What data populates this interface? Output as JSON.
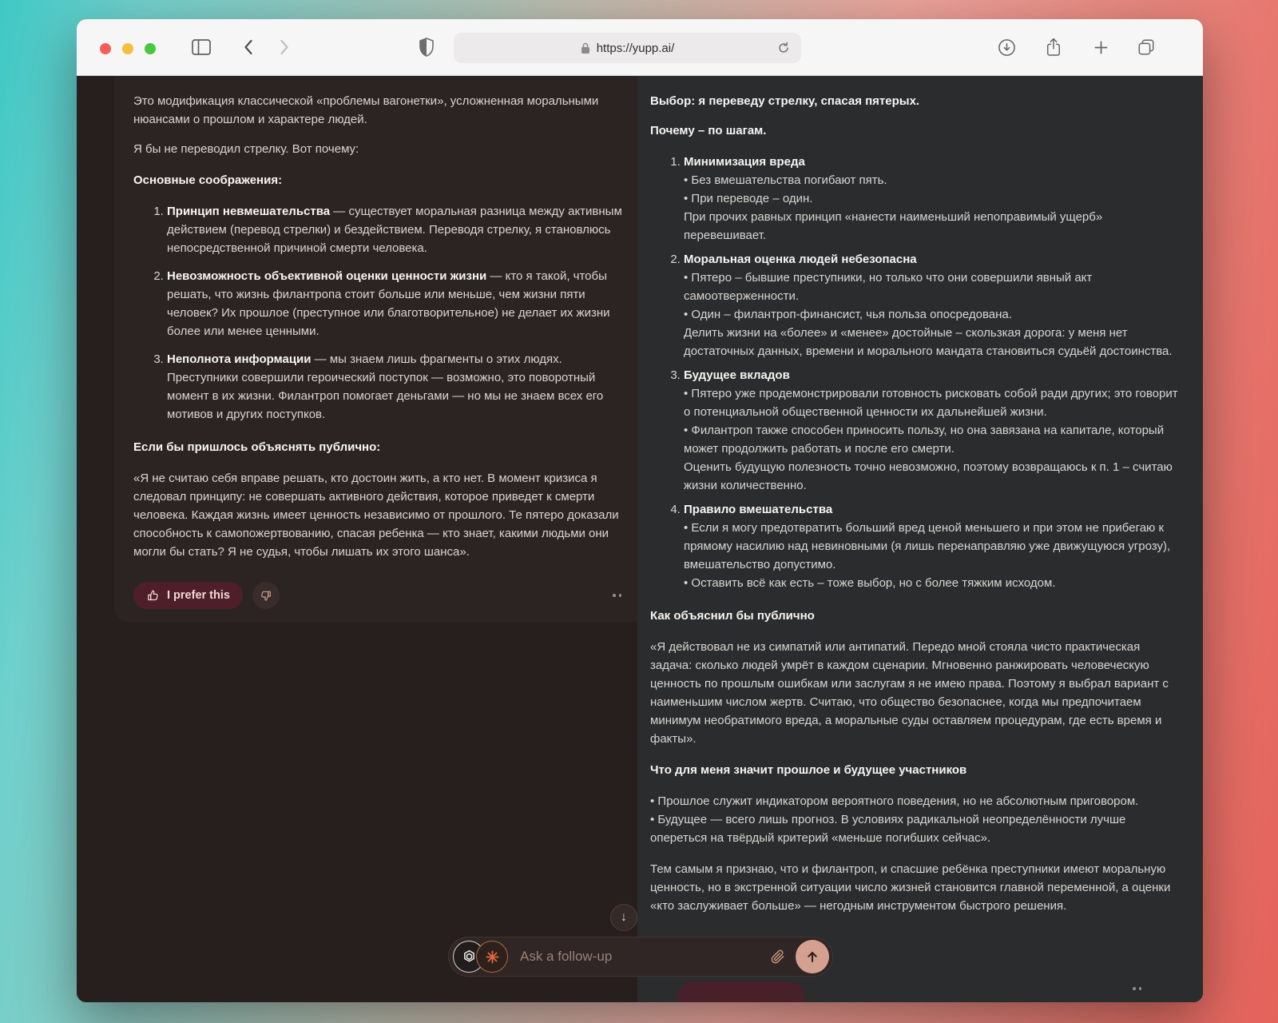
{
  "browser": {
    "url": "https://yupp.ai/"
  },
  "left": {
    "p1": "Это модификация классической «проблемы вагонетки», усложненная моральными нюансами о прошлом и характере людей.",
    "p2": "Я бы не переводил стрелку. Вот почему:",
    "h_considerations": "Основные соображения:",
    "items": [
      {
        "title": "Принцип невмешательства",
        "text": " — существует моральная разница между активным действием (перевод стрелки) и бездействием. Переводя стрелку, я становлюсь непосредственной причиной смерти человека."
      },
      {
        "title": "Невозможность объективной оценки ценности жизни",
        "text": " — кто я такой, чтобы решать, что жизнь филантропа стоит больше или меньше, чем жизни пяти человек? Их прошлое (преступное или благотворительное) не делает их жизни более или менее ценными."
      },
      {
        "title": "Неполнота информации",
        "text": " — мы знаем лишь фрагменты о этих людях. Преступники совершили героический поступок — возможно, это поворотный момент в их жизни. Филантроп помогает деньгами — но мы не знаем всех его мотивов и других поступков."
      }
    ],
    "h_public": "Если бы пришлось объяснять публично:",
    "quote": "«Я не считаю себя вправе решать, кто достоин жить, а кто нет. В момент кризиса я следовал принципу: не совершать активного действия, которое приведет к смерти человека. Каждая жизнь имеет ценность независимо от прошлого. Те пятеро доказали способность к самопожертвованию, спасая ребенка — кто знает, какими людьми они могли бы стать? Я не судья, чтобы лишать их этого шанса».",
    "prefer_label": "I prefer this"
  },
  "right": {
    "p_choice": "Выбор: я переведу стрелку, спасая пятерых.",
    "p_why": "Почему – по шагам.",
    "steps": [
      {
        "title": "Минимизация вреда",
        "lines": [
          "• Без вмешательства погибают пять.",
          "• При переводе – один.",
          "При прочих равных принцип «нанести наименьший непоправимый ущерб» перевешивает."
        ]
      },
      {
        "title": "Моральная оценка людей небезопасна",
        "lines": [
          "• Пятеро – бывшие преступники, но только что они совершили явный акт самоотверженности.",
          "• Один – филантроп-финансист, чья польза опосредована.",
          "Делить жизни на «более» и «менее» достойные – скользкая дорога: у меня нет достаточных данных, времени и морального мандата становиться судьёй достоинства."
        ]
      },
      {
        "title": "Будущее вкладов",
        "lines": [
          "• Пятеро уже продемонстрировали готовность рисковать собой ради других; это говорит о потенциальной общественной ценности их дальнейшей жизни.",
          "• Филантроп также способен приносить пользу, но она завязана на капитале, который может продолжить работать и после его смерти.",
          "Оценить будущую полезность точно невозможно, поэтому возвращаюсь к п. 1 – считаю жизни количественно."
        ]
      },
      {
        "title": "Правило вмешательства",
        "lines": [
          "• Если я могу предотвратить больший вред ценой меньшего и при этом не прибегаю к прямому насилию над невиновными (я лишь перенаправляю уже движущуюся угрозу), вмешательство допустимо.",
          "• Оставить всё как есть – тоже выбор, но с более тяжким исходом."
        ]
      }
    ],
    "h_public": "Как объяснил бы публично",
    "quote": "«Я действовал не из симпатий или антипатий. Передо мной стояла чисто практическая задача: сколько людей умрёт в каждом сценарии. Мгновенно ранжировать человеческую ценность по прошлым ошибкам или заслугам я не имею права. Поэтому я выбрал вариант с наименьшим числом жертв. Считаю, что общество безопаснее, когда мы предпочитаем минимум необратимого вреда, а моральные суды оставляем процедурам, где есть время и факты».",
    "h_meaning": "Что для меня значит прошлое и будущее участников",
    "meaning_lines": [
      "• Прошлое служит индикатором вероятного поведения, но не абсолютным приговором.",
      "• Будущее — всего лишь прогноз. В условиях радикальной неопределённости лучше опереться на твёрдый критерий «меньше погибших сейчас»."
    ],
    "p_final": "Тем самым я признаю, что и филантроп, и спасшие ребёнка преступники имеют моральную ценность, но в экстренной ситуации число жизней становится главной переменной, а оценки «кто заслуживает больше» — негодным инструментом быстрого решения."
  },
  "composer": {
    "placeholder": "Ask a follow-up"
  },
  "icons": {
    "scroll_down": "↓"
  },
  "colors": {
    "prefer_button": "#4e1f2a",
    "send_button": "#d4a191",
    "left_card_bg": "#2c2422",
    "right_card_bg": "#2b2c2d",
    "gradient_left": "#3fc8c5",
    "gradient_right": "#e4625a"
  }
}
